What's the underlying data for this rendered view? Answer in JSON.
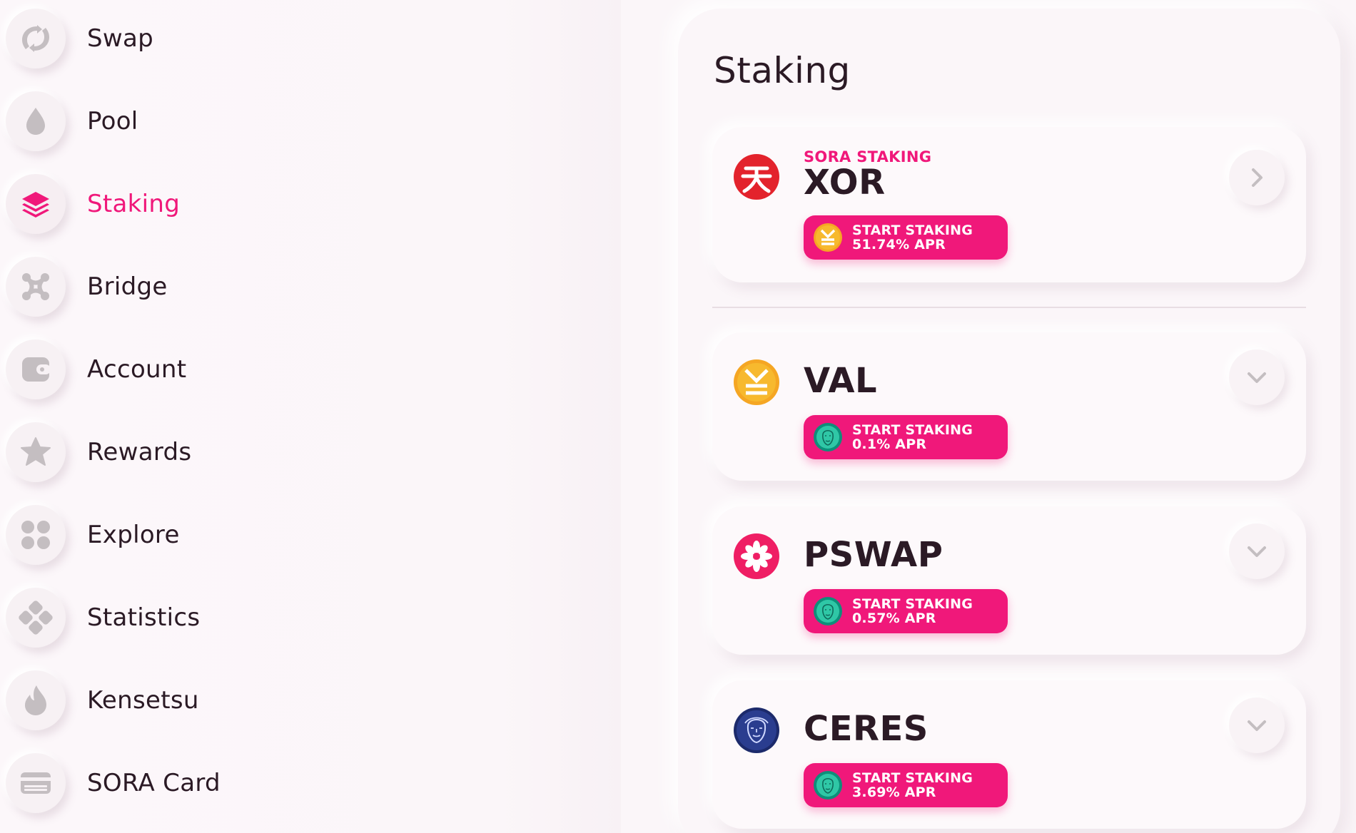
{
  "sidebar": {
    "items": [
      {
        "label": "Swap",
        "icon": "swap-icon",
        "active": false
      },
      {
        "label": "Pool",
        "icon": "pool-icon",
        "active": false
      },
      {
        "label": "Staking",
        "icon": "staking-icon",
        "active": true
      },
      {
        "label": "Bridge",
        "icon": "bridge-icon",
        "active": false
      },
      {
        "label": "Account",
        "icon": "wallet-icon",
        "active": false
      },
      {
        "label": "Rewards",
        "icon": "star-icon",
        "active": false
      },
      {
        "label": "Explore",
        "icon": "explore-icon",
        "active": false
      },
      {
        "label": "Statistics",
        "icon": "statistics-icon",
        "active": false
      },
      {
        "label": "Kensetsu",
        "icon": "flame-icon",
        "active": false
      },
      {
        "label": "SORA Card",
        "icon": "card-icon",
        "active": false
      }
    ]
  },
  "main": {
    "title": "Staking",
    "cards": [
      {
        "kicker": "SORA STAKING",
        "token": "XOR",
        "token_icon": "xor-logo",
        "button_line1": "START STAKING",
        "button_line2": "51.74% APR",
        "reward_icon": "val-logo",
        "chevron": "chevron-right-icon"
      },
      {
        "token": "VAL",
        "token_icon": "val-logo",
        "button_line1": "START STAKING",
        "button_line2": "0.1% APR",
        "reward_icon": "ceres-green-logo",
        "chevron": "chevron-down-icon"
      },
      {
        "token": "PSWAP",
        "token_icon": "pswap-logo",
        "button_line1": "START STAKING",
        "button_line2": "0.57% APR",
        "reward_icon": "ceres-green-logo",
        "chevron": "chevron-down-icon"
      },
      {
        "token": "CERES",
        "token_icon": "ceres-logo",
        "button_line1": "START STAKING",
        "button_line2": "3.69% APR",
        "reward_icon": "ceres-green-logo",
        "chevron": "chevron-down-icon"
      }
    ]
  },
  "colors": {
    "accent": "#f0187a",
    "background": "#fbf6f9",
    "text": "#2b1a25",
    "icon_gray": "#c4bec1"
  }
}
